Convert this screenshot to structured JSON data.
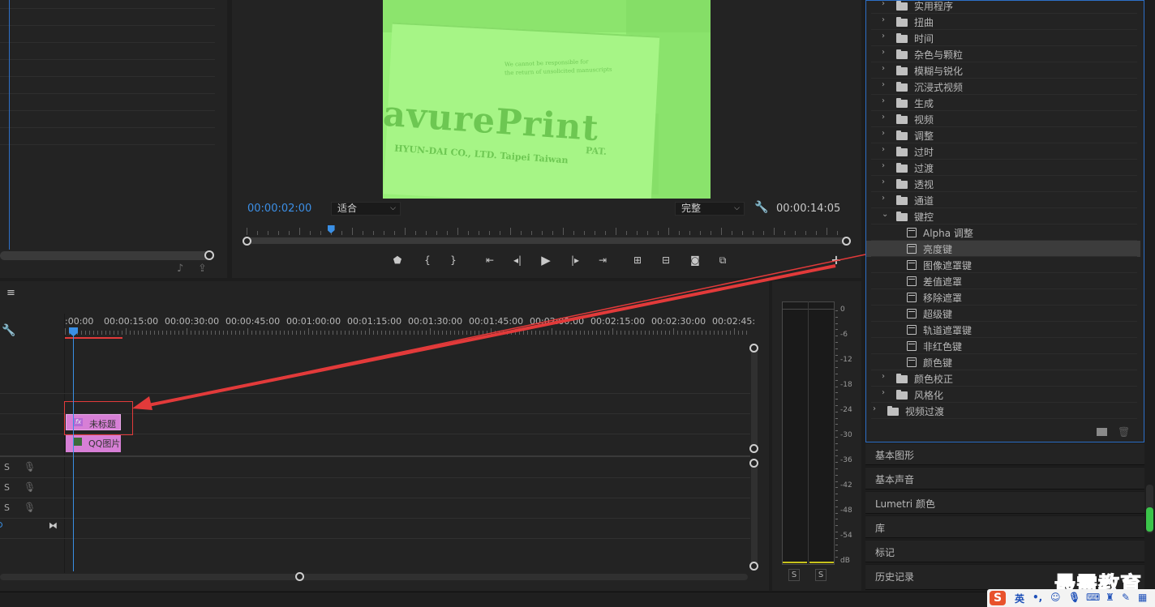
{
  "monitor": {
    "timecode": "00:00:02:00",
    "fit": "适合",
    "quality": "完整",
    "duration": "00:00:14:05",
    "playhead_fraction": 0.14
  },
  "video_frame": {
    "brand": "avurePrint",
    "subline": "HYUN-DAI CO., LTD. Taipei Taiwan",
    "disclaimer_1": "We cannot be responsible for",
    "disclaimer_2": "the return of unsolicited manuscripts",
    "pat": "PAT."
  },
  "timeline": {
    "menu_icon": "≡",
    "ruler_labels": [
      ":00:00",
      "00:00:15:00",
      "00:00:30:00",
      "00:00:45:00",
      "00:01:00:00",
      "00:01:15:00",
      "00:01:30:00",
      "00:01:45:00",
      "00:02:00:00",
      "00:02:15:00",
      "00:02:30:00",
      "00:02:45:"
    ],
    "clips": [
      {
        "label": "未标题",
        "icon": "fx"
      },
      {
        "label": "QQ图片",
        "icon": "img"
      }
    ],
    "audio_tracks": [
      {
        "solo": "S"
      },
      {
        "solo": "S"
      },
      {
        "solo": "S"
      }
    ]
  },
  "meter": {
    "scale": [
      "0",
      "-6",
      "-12",
      "-18",
      "-24",
      "-30",
      "-36",
      "-42",
      "-48",
      "-54",
      "dB"
    ],
    "solo_left": "S",
    "solo_right": "S",
    "colors": {
      "level": "#c7c21d"
    }
  },
  "effects": {
    "items": [
      {
        "type": "folder",
        "label": "实用程序",
        "expanded": false,
        "level": 1
      },
      {
        "type": "folder",
        "label": "扭曲",
        "expanded": false,
        "level": 1
      },
      {
        "type": "folder",
        "label": "时间",
        "expanded": false,
        "level": 1
      },
      {
        "type": "folder",
        "label": "杂色与颗粒",
        "expanded": false,
        "level": 1
      },
      {
        "type": "folder",
        "label": "模糊与锐化",
        "expanded": false,
        "level": 1
      },
      {
        "type": "folder",
        "label": "沉浸式视频",
        "expanded": false,
        "level": 1
      },
      {
        "type": "folder",
        "label": "生成",
        "expanded": false,
        "level": 1
      },
      {
        "type": "folder",
        "label": "视频",
        "expanded": false,
        "level": 1
      },
      {
        "type": "folder",
        "label": "调整",
        "expanded": false,
        "level": 1
      },
      {
        "type": "folder",
        "label": "过时",
        "expanded": false,
        "level": 1
      },
      {
        "type": "folder",
        "label": "过渡",
        "expanded": false,
        "level": 1
      },
      {
        "type": "folder",
        "label": "透视",
        "expanded": false,
        "level": 1
      },
      {
        "type": "folder",
        "label": "通道",
        "expanded": false,
        "level": 1
      },
      {
        "type": "folder",
        "label": "键控",
        "expanded": true,
        "level": 1
      },
      {
        "type": "effect",
        "label": "Alpha 调整",
        "level": 2
      },
      {
        "type": "effect",
        "label": "亮度键",
        "level": 2,
        "selected": true
      },
      {
        "type": "effect",
        "label": "图像遮罩键",
        "level": 2
      },
      {
        "type": "effect",
        "label": "差值遮罩",
        "level": 2
      },
      {
        "type": "effect",
        "label": "移除遮罩",
        "level": 2
      },
      {
        "type": "effect",
        "label": "超级键",
        "level": 2
      },
      {
        "type": "effect",
        "label": "轨道遮罩键",
        "level": 2
      },
      {
        "type": "effect",
        "label": "非红色键",
        "level": 2
      },
      {
        "type": "effect",
        "label": "颜色键",
        "level": 2
      },
      {
        "type": "folder",
        "label": "颜色校正",
        "expanded": false,
        "level": 1
      },
      {
        "type": "folder",
        "label": "风格化",
        "expanded": false,
        "level": 1
      },
      {
        "type": "folder",
        "label": "视频过渡",
        "expanded": false,
        "level": 0
      }
    ]
  },
  "panels": [
    "基本图形",
    "基本声音",
    "Lumetri 颜色",
    "库",
    "标记",
    "历史记录"
  ],
  "watermark": "最需教育",
  "ime": {
    "logo": "S",
    "lang": "英",
    "punct": "•,"
  },
  "colors": {
    "accent_blue": "#3a8fe5",
    "annotation_red": "#e23a3a",
    "clip_pink": "#d77fd6",
    "video_green": "#98f078"
  }
}
